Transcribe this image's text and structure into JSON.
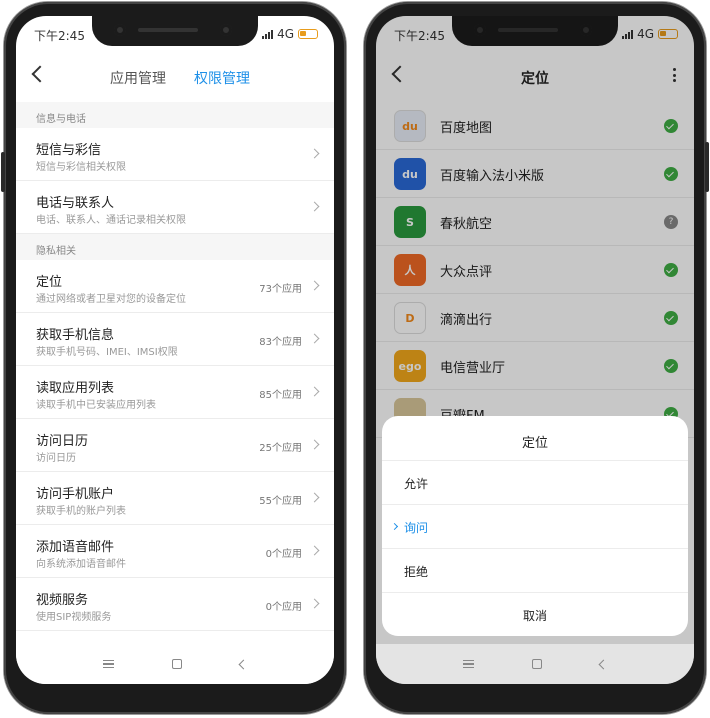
{
  "status": {
    "time": "下午2:45",
    "network": "4G"
  },
  "left": {
    "tabs": [
      {
        "label": "应用管理"
      },
      {
        "label": "权限管理"
      }
    ],
    "sections": [
      {
        "label": "信息与电话",
        "rows": [
          {
            "title": "短信与彩信",
            "sub": "短信与彩信相关权限",
            "count": ""
          },
          {
            "title": "电话与联系人",
            "sub": "电话、联系人、通话记录相关权限",
            "count": ""
          }
        ]
      },
      {
        "label": "隐私相关",
        "rows": [
          {
            "title": "定位",
            "sub": "通过网络或者卫星对您的设备定位",
            "count": "73个应用"
          },
          {
            "title": "获取手机信息",
            "sub": "获取手机号码、IMEI、IMSI权限",
            "count": "83个应用"
          },
          {
            "title": "读取应用列表",
            "sub": "读取手机中已安装应用列表",
            "count": "85个应用"
          },
          {
            "title": "访问日历",
            "sub": "访问日历",
            "count": "25个应用"
          },
          {
            "title": "访问手机账户",
            "sub": "获取手机的账户列表",
            "count": "55个应用"
          },
          {
            "title": "添加语音邮件",
            "sub": "向系统添加语音邮件",
            "count": "0个应用"
          },
          {
            "title": "视频服务",
            "sub": "使用SIP视频服务",
            "count": "0个应用"
          }
        ]
      }
    ]
  },
  "right": {
    "title": "定位",
    "apps": [
      {
        "name": "百度地图",
        "icon_text": "du",
        "color": "#e8eef8",
        "state": "allowed"
      },
      {
        "name": "百度输入法小米版",
        "icon_text": "du",
        "color": "#2a6ad8",
        "state": "allowed"
      },
      {
        "name": "春秋航空",
        "icon_text": "S",
        "color": "#2a9a3e",
        "state": "ask"
      },
      {
        "name": "大众点评",
        "icon_text": "人",
        "color": "#f06a26",
        "state": "allowed"
      },
      {
        "name": "滴滴出行",
        "icon_text": "D",
        "color": "#ffffff",
        "state": "allowed"
      },
      {
        "name": "电信营业厅",
        "icon_text": "ego",
        "color": "#f2a81c",
        "state": "allowed"
      },
      {
        "name": "豆瓣FM",
        "icon_text": "",
        "color": "#d9c79a",
        "state": "allowed"
      }
    ],
    "sheet": {
      "title": "定位",
      "options": [
        {
          "label": "允许"
        },
        {
          "label": "询问"
        },
        {
          "label": "拒绝"
        }
      ],
      "selected_index": 1,
      "cancel": "取消"
    }
  },
  "colors": {
    "accent": "#1e90e8",
    "check": "#3fae44"
  }
}
